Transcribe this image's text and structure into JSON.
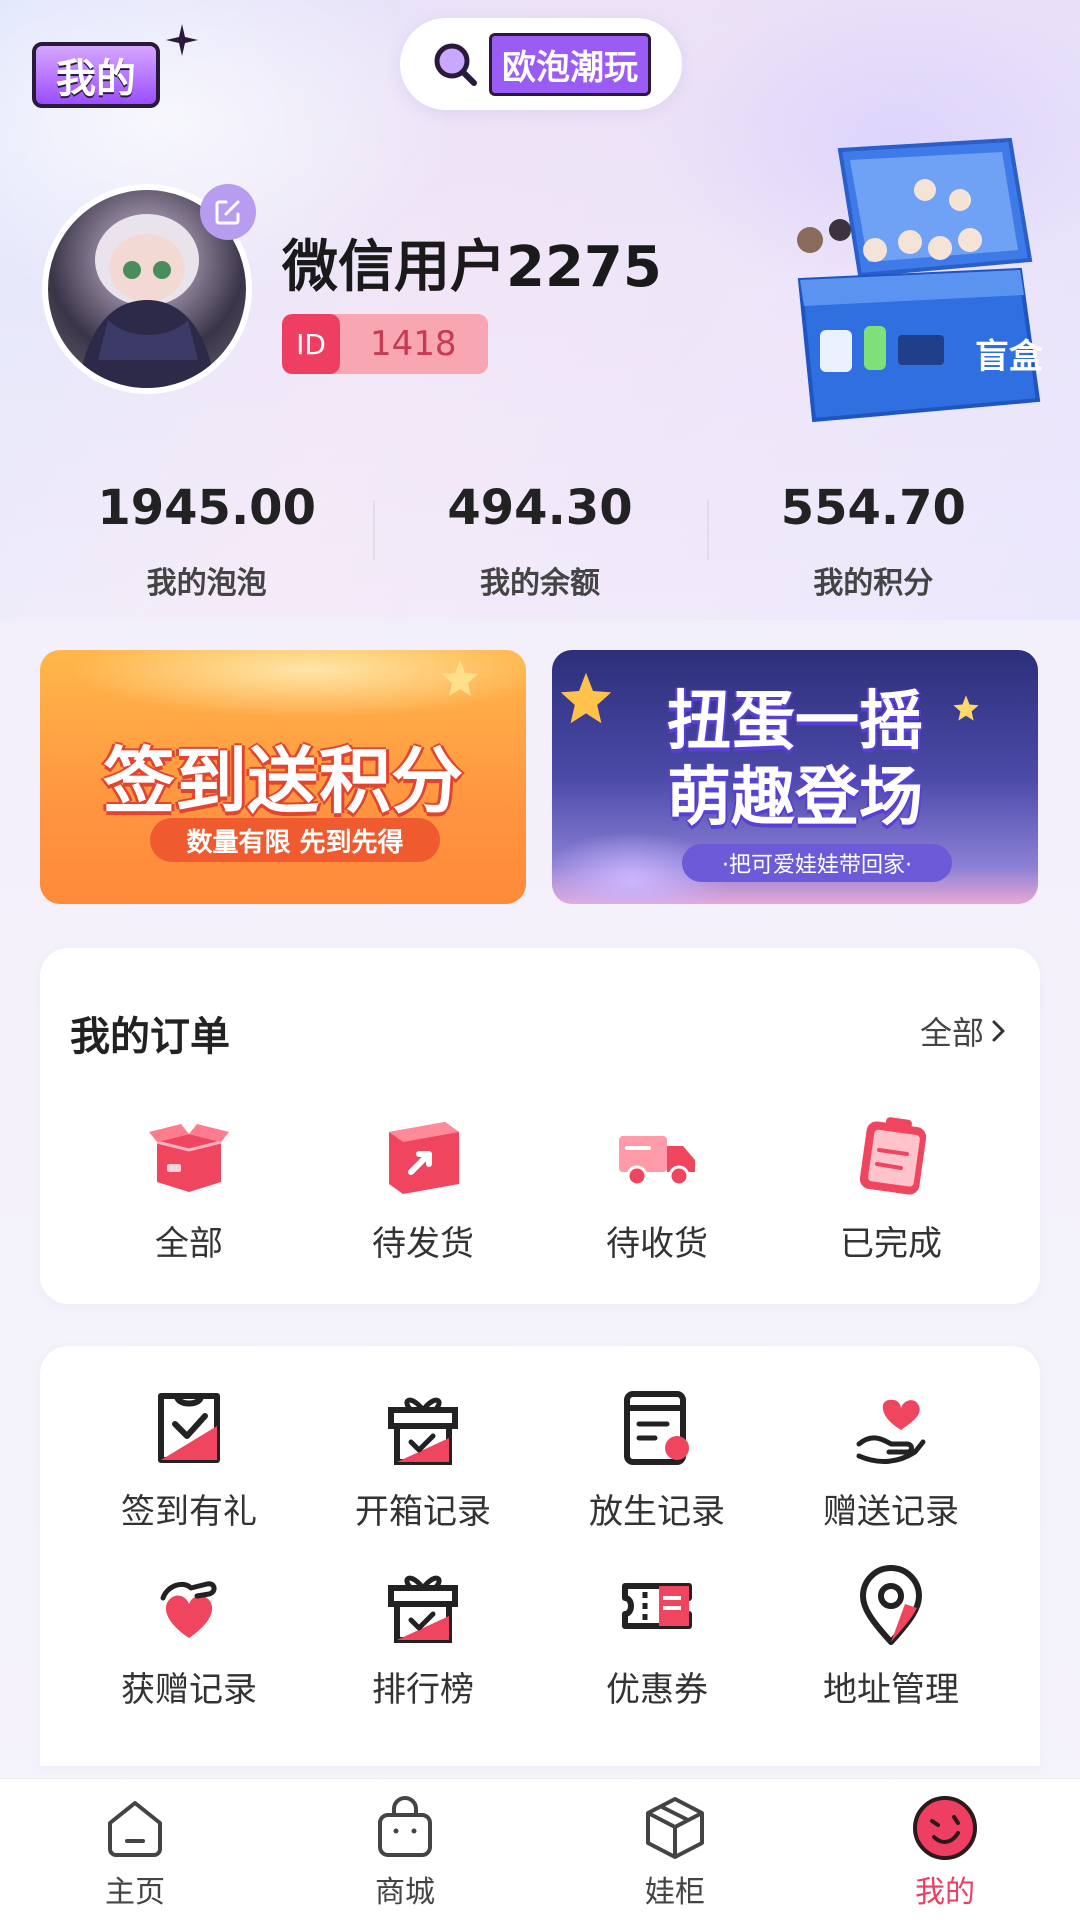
{
  "header": {
    "page_title": "我的",
    "search_text": "欧泡潮玩"
  },
  "profile": {
    "username": "微信用户2275",
    "id_label": "ID",
    "id_value": "1418",
    "box_label": "盲盒"
  },
  "stats": [
    {
      "value": "1945.00",
      "label": "我的泡泡"
    },
    {
      "value": "494.30",
      "label": "我的余额"
    },
    {
      "value": "554.70",
      "label": "我的积分"
    }
  ],
  "banners": [
    {
      "title": "签到送积分",
      "subtitle": "数量有限 先到先得"
    },
    {
      "title_line1": "扭蛋一摇",
      "title_line2": "萌趣登场",
      "subtitle": "·把可爱娃娃带回家·"
    }
  ],
  "orders": {
    "title": "我的订单",
    "all_link": "全部",
    "items": [
      {
        "label": "全部",
        "icon": "open-box-icon"
      },
      {
        "label": "待发货",
        "icon": "package-icon"
      },
      {
        "label": "待收货",
        "icon": "truck-icon"
      },
      {
        "label": "已完成",
        "icon": "clipboard-icon"
      }
    ]
  },
  "services": [
    {
      "label": "签到有礼",
      "icon": "checkin-icon"
    },
    {
      "label": "开箱记录",
      "icon": "gift-box-icon"
    },
    {
      "label": "放生记录",
      "icon": "record-icon"
    },
    {
      "label": "赠送记录",
      "icon": "heart-hand-icon"
    },
    {
      "label": "获赠记录",
      "icon": "heart-received-icon"
    },
    {
      "label": "排行榜",
      "icon": "ranking-icon"
    },
    {
      "label": "优惠券",
      "icon": "coupon-icon"
    },
    {
      "label": "地址管理",
      "icon": "location-icon"
    }
  ],
  "tabbar": [
    {
      "label": "主页",
      "icon": "home-icon"
    },
    {
      "label": "商城",
      "icon": "shopping-bag-icon"
    },
    {
      "label": "娃柜",
      "icon": "cube-box-icon"
    },
    {
      "label": "我的",
      "icon": "profile-face-icon",
      "active": true
    }
  ],
  "colors": {
    "accent": "#ee3f63",
    "purple": "#9b5cf6"
  }
}
